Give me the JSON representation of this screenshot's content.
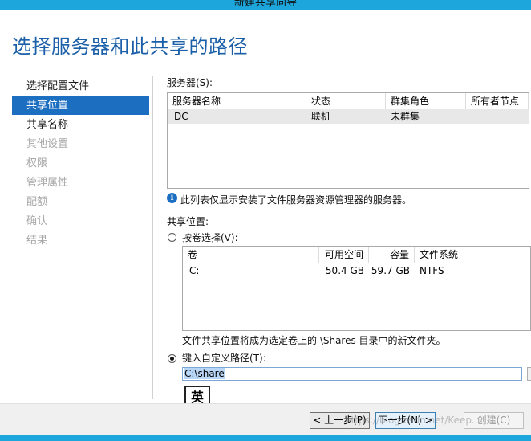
{
  "window": {
    "title": "新建共享向导"
  },
  "page_title": "选择服务器和此共享的路径",
  "nav": {
    "items": [
      {
        "label": "选择配置文件",
        "state": "enabled"
      },
      {
        "label": "共享位置",
        "state": "selected"
      },
      {
        "label": "共享名称",
        "state": "enabled"
      },
      {
        "label": "其他设置",
        "state": "disabled"
      },
      {
        "label": "权限",
        "state": "disabled"
      },
      {
        "label": "管理属性",
        "state": "disabled"
      },
      {
        "label": "配额",
        "state": "disabled"
      },
      {
        "label": "确认",
        "state": "disabled"
      },
      {
        "label": "结果",
        "state": "disabled"
      }
    ]
  },
  "servers": {
    "label": "服务器(S):",
    "columns": [
      "服务器名称",
      "状态",
      "群集角色",
      "所有者节点"
    ],
    "rows": [
      [
        "DC",
        "联机",
        "未群集",
        ""
      ]
    ]
  },
  "info_text": "此列表仅显示安装了文件服务器资源管理器的服务器。",
  "share_location": {
    "label": "共享位置:",
    "volume_option": {
      "label": "按卷选择(V):",
      "selected": false
    },
    "columns": [
      "卷",
      "可用空间",
      "容量",
      "文件系统"
    ],
    "rows": [
      [
        "C:",
        "50.4 GB",
        "59.7 GB",
        "NTFS"
      ]
    ],
    "note": "文件共享位置将成为选定卷上的 \\Shares 目录中的新文件夹。",
    "custom_option": {
      "label": "键入自定义路径(T):",
      "selected": true
    },
    "custom_path": "C:\\share"
  },
  "ime_indicator": "英",
  "buttons": {
    "previous": "< 上一步(P)",
    "next": "下一步(N) >",
    "create": "创建(C)"
  },
  "watermark": "https://blog.csdn.net/Keep..."
}
